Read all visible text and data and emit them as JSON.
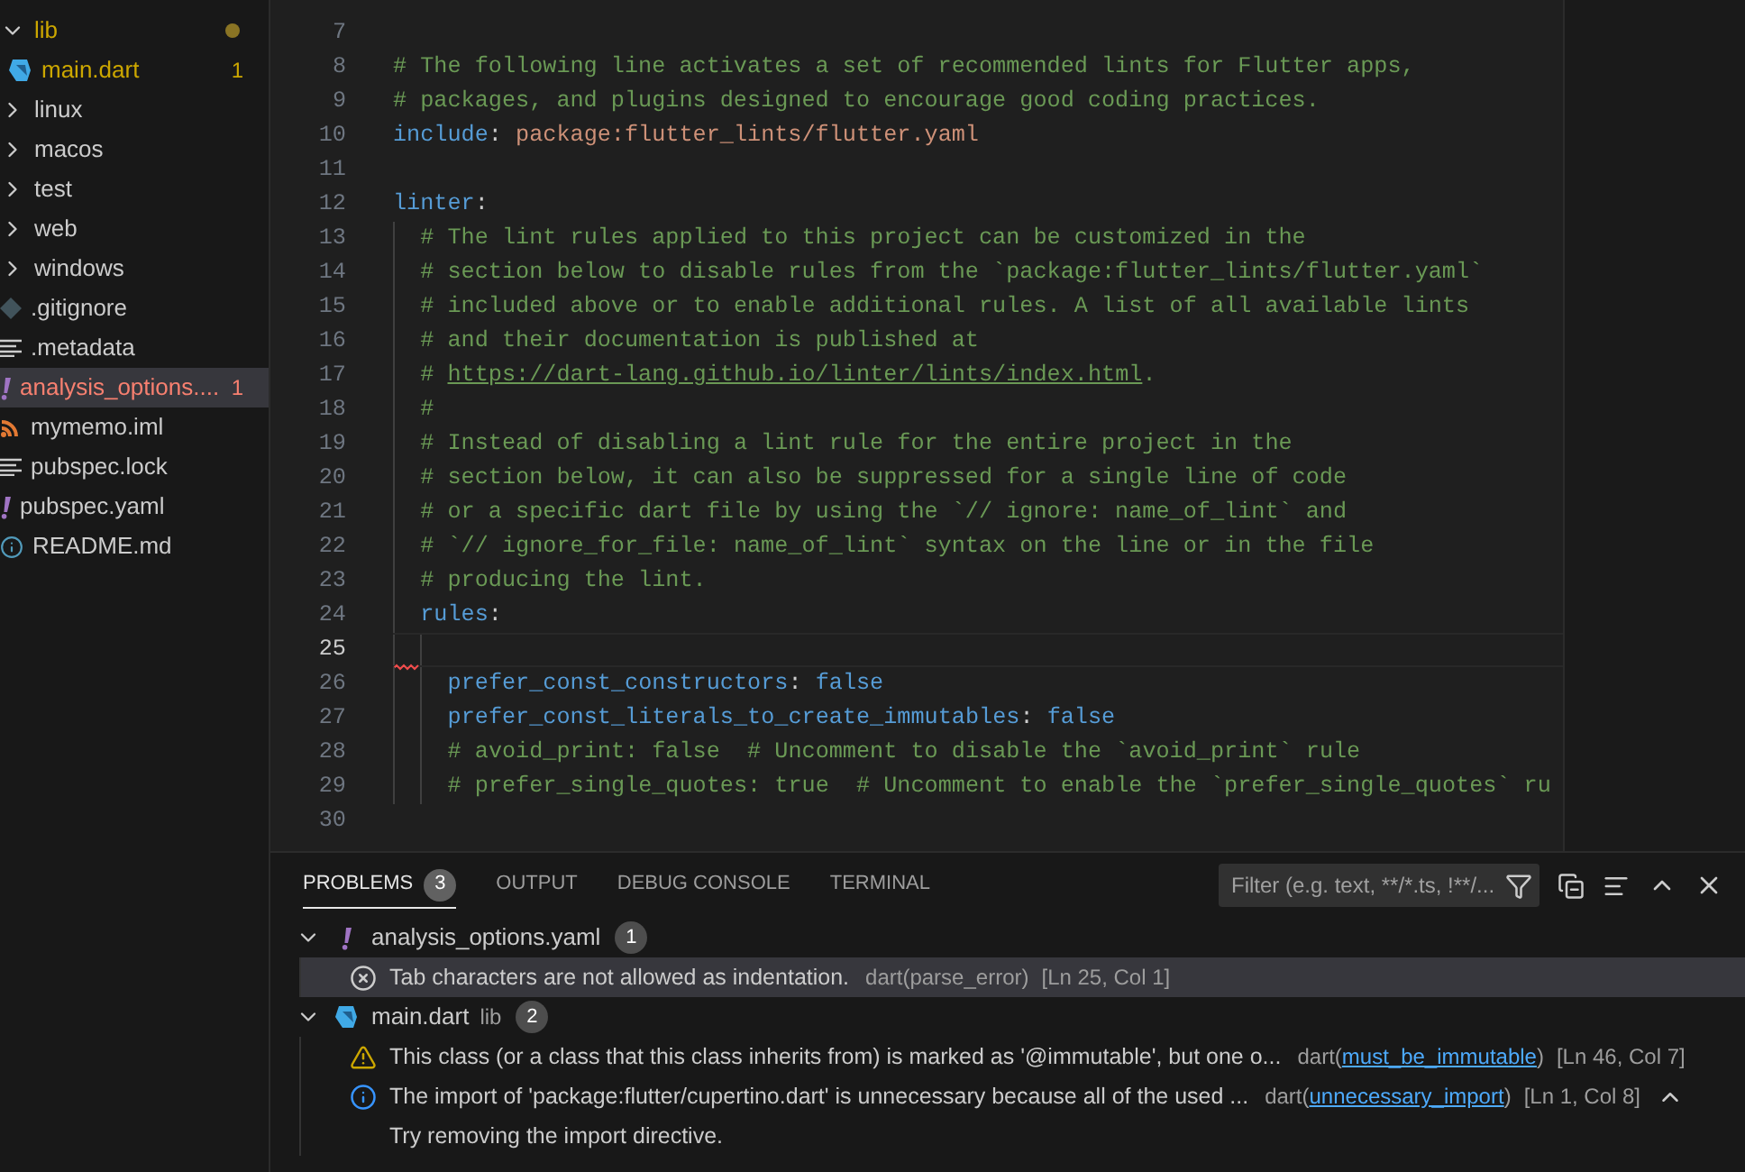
{
  "explorer": {
    "items": [
      {
        "kind": "folder",
        "label": "lib",
        "expanded": true,
        "modified": true,
        "problem": false,
        "dot": true,
        "selected": false,
        "children": [
          {
            "kind": "dart",
            "label": "main.dart",
            "modified": true,
            "problem": false,
            "badge": "1",
            "selected": false
          }
        ]
      },
      {
        "kind": "folder",
        "label": "linux",
        "expanded": false,
        "modified": false,
        "problem": false,
        "selected": false
      },
      {
        "kind": "folder",
        "label": "macos",
        "expanded": false,
        "modified": false,
        "problem": false,
        "selected": false
      },
      {
        "kind": "folder",
        "label": "test",
        "expanded": false,
        "modified": false,
        "problem": false,
        "selected": false
      },
      {
        "kind": "folder",
        "label": "web",
        "expanded": false,
        "modified": false,
        "problem": false,
        "selected": false
      },
      {
        "kind": "folder",
        "label": "windows",
        "expanded": false,
        "modified": false,
        "problem": false,
        "selected": false
      },
      {
        "kind": "git",
        "label": ".gitignore",
        "modified": false,
        "problem": false,
        "selected": false
      },
      {
        "kind": "lines",
        "label": ".metadata",
        "modified": false,
        "problem": false,
        "selected": false
      },
      {
        "kind": "yaml",
        "label": "analysis_options....",
        "modified": false,
        "problem": true,
        "badge": "1",
        "selected": true
      },
      {
        "kind": "rss",
        "label": "mymemo.iml",
        "modified": false,
        "problem": false,
        "selected": false
      },
      {
        "kind": "lines",
        "label": "pubspec.lock",
        "modified": false,
        "problem": false,
        "selected": false
      },
      {
        "kind": "yaml",
        "label": "pubspec.yaml",
        "modified": false,
        "problem": false,
        "selected": false
      },
      {
        "kind": "info",
        "label": "README.md",
        "modified": false,
        "problem": false,
        "selected": false
      }
    ]
  },
  "editor": {
    "lines": [
      {
        "number": "7",
        "current": false,
        "error": false
      },
      {
        "number": "8",
        "current": false,
        "error": false,
        "tokens": [
          {
            "kind": "comment",
            "text": "# The following line activates a set of recommended lints for Flutter apps,"
          }
        ]
      },
      {
        "number": "9",
        "current": false,
        "error": false,
        "tokens": [
          {
            "kind": "comment",
            "text": "# packages, and plugins designed to encourage good coding practices."
          }
        ]
      },
      {
        "number": "10",
        "current": false,
        "error": false,
        "tokens": [
          {
            "kind": "key",
            "text": "include"
          },
          {
            "kind": "plain",
            "text": ": "
          },
          {
            "kind": "string",
            "text": "package:flutter_lints/flutter.yaml"
          }
        ]
      },
      {
        "number": "11",
        "current": false,
        "error": false
      },
      {
        "number": "12",
        "current": false,
        "error": false,
        "tokens": [
          {
            "kind": "key",
            "text": "linter"
          },
          {
            "kind": "plain",
            "text": ":"
          }
        ],
        "children": [
          {
            "number": "13",
            "current": false,
            "error": false,
            "tokens": [
              {
                "kind": "comment",
                "text": "# The lint rules applied to this project can be customized in the"
              }
            ]
          },
          {
            "number": "14",
            "current": false,
            "error": false,
            "tokens": [
              {
                "kind": "comment",
                "text": "# section below to disable rules from the `package:flutter_lints/flutter.yaml`"
              }
            ]
          },
          {
            "number": "15",
            "current": false,
            "error": false,
            "tokens": [
              {
                "kind": "comment",
                "text": "# included above or to enable additional rules. A list of all available lints"
              }
            ]
          },
          {
            "number": "16",
            "current": false,
            "error": false,
            "tokens": [
              {
                "kind": "comment",
                "text": "# and their documentation is published at"
              }
            ]
          },
          {
            "number": "17",
            "current": false,
            "error": false,
            "tokens": [
              {
                "kind": "comment",
                "text": "# "
              },
              {
                "kind": "link",
                "text": "https://dart-lang.github.io/linter/lints/index.html"
              },
              {
                "kind": "comment",
                "text": "."
              }
            ]
          },
          {
            "number": "18",
            "current": false,
            "error": false,
            "tokens": [
              {
                "kind": "comment",
                "text": "#"
              }
            ]
          },
          {
            "number": "19",
            "current": false,
            "error": false,
            "tokens": [
              {
                "kind": "comment",
                "text": "# Instead of disabling a lint rule for the entire project in the"
              }
            ]
          },
          {
            "number": "20",
            "current": false,
            "error": false,
            "tokens": [
              {
                "kind": "comment",
                "text": "# section below, it can also be suppressed for a single line of code"
              }
            ]
          },
          {
            "number": "21",
            "current": false,
            "error": false,
            "tokens": [
              {
                "kind": "comment",
                "text": "# or a specific dart file by using the `// ignore: name_of_lint` and"
              }
            ]
          },
          {
            "number": "22",
            "current": false,
            "error": false,
            "tokens": [
              {
                "kind": "comment",
                "text": "# `// ignore_for_file: name_of_lint` syntax on the line or in the file"
              }
            ]
          },
          {
            "number": "23",
            "current": false,
            "error": false,
            "tokens": [
              {
                "kind": "comment",
                "text": "# producing the lint."
              }
            ]
          },
          {
            "number": "24",
            "current": false,
            "error": false,
            "tokens": [
              {
                "kind": "key",
                "text": "rules"
              },
              {
                "kind": "plain",
                "text": ":"
              }
            ],
            "children": [
              {
                "number": "25",
                "current": true,
                "error": true
              },
              {
                "number": "26",
                "current": false,
                "error": false,
                "tokens": [
                  {
                    "kind": "key",
                    "text": "prefer_const_constructors"
                  },
                  {
                    "kind": "plain",
                    "text": ": "
                  },
                  {
                    "kind": "key",
                    "text": "false"
                  }
                ]
              },
              {
                "number": "27",
                "current": false,
                "error": false,
                "tokens": [
                  {
                    "kind": "key",
                    "text": "prefer_const_literals_to_create_immutables"
                  },
                  {
                    "kind": "plain",
                    "text": ": "
                  },
                  {
                    "kind": "key",
                    "text": "false"
                  }
                ]
              },
              {
                "number": "28",
                "current": false,
                "error": false,
                "tokens": [
                  {
                    "kind": "comment",
                    "text": "# avoid_print: false  # Uncomment to disable the `avoid_print` rule"
                  }
                ]
              },
              {
                "number": "29",
                "current": false,
                "error": false,
                "tokens": [
                  {
                    "kind": "comment",
                    "text": "# prefer_single_quotes: true  # Uncomment to enable the `prefer_single_quotes` ru"
                  }
                ]
              }
            ]
          }
        ]
      },
      {
        "number": "30",
        "current": false,
        "error": false
      }
    ]
  },
  "panel": {
    "tabs": [
      {
        "label": "PROBLEMS",
        "badge": "3",
        "selected": true
      },
      {
        "label": "OUTPUT",
        "selected": false
      },
      {
        "label": "DEBUG CONSOLE",
        "selected": false
      },
      {
        "label": "TERMINAL",
        "selected": false
      }
    ],
    "filter": {
      "placeholder": "Filter (e.g. text, **/*.ts, !**/..."
    },
    "groups": [
      {
        "kind": "yaml",
        "file": "analysis_options.yaml",
        "count": "1",
        "expanded": true,
        "problems": [
          {
            "kind": "error",
            "message": "Tab characters are not allowed as indentation.",
            "source": [
              {
                "text": "dart(parse_error)",
                "link": false
              }
            ],
            "location": "[Ln 25, Col 1]",
            "selected": true,
            "expanded": false
          }
        ]
      },
      {
        "kind": "dart",
        "file": "main.dart",
        "folder": "lib",
        "count": "2",
        "expanded": true,
        "problems": [
          {
            "kind": "warning",
            "message": "This class (or a class that this class inherits from) is marked as '@immutable', but one o...",
            "source": [
              {
                "text": "dart(",
                "link": false
              },
              {
                "text": "must_be_immutable",
                "link": true
              },
              {
                "text": ")",
                "link": false
              }
            ],
            "location": "[Ln 46, Col 7]",
            "selected": false,
            "expanded": false
          },
          {
            "kind": "info",
            "message": "The import of 'package:flutter/cupertino.dart' is unnecessary because all of the used ...",
            "source": [
              {
                "text": "dart(",
                "link": false
              },
              {
                "text": "unnecessary_import",
                "link": true
              },
              {
                "text": ")",
                "link": false
              }
            ],
            "location": "[Ln 1, Col 8]",
            "selected": false,
            "expanded": true,
            "detail": "Try removing the import directive."
          }
        ]
      }
    ]
  }
}
